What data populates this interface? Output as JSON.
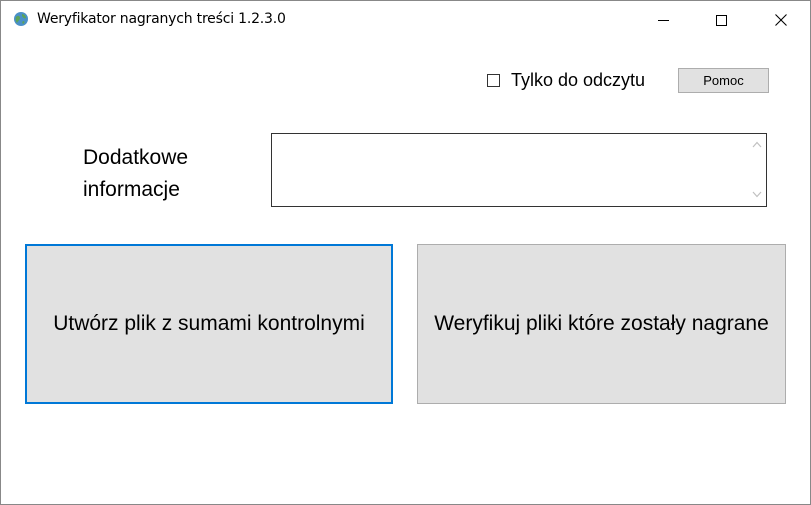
{
  "window": {
    "title": "Weryfikator nagranych treści 1.2.3.0",
    "icon": "globe-icon"
  },
  "controls": {
    "minimize": "minimize-icon",
    "maximize": "maximize-icon",
    "close": "close-icon"
  },
  "top": {
    "readonly_label": "Tylko do odczytu",
    "readonly_checked": false,
    "help_label": "Pomoc"
  },
  "info": {
    "label": "Dodatkowe\ninformacje",
    "value": ""
  },
  "actions": {
    "create_label": "Utwórz plik z sumami kontrolnymi",
    "verify_label": "Weryfikuj pliki które zostały nagrane"
  },
  "colors": {
    "button_bg": "#e1e1e1",
    "focus_border": "#0078d7"
  }
}
